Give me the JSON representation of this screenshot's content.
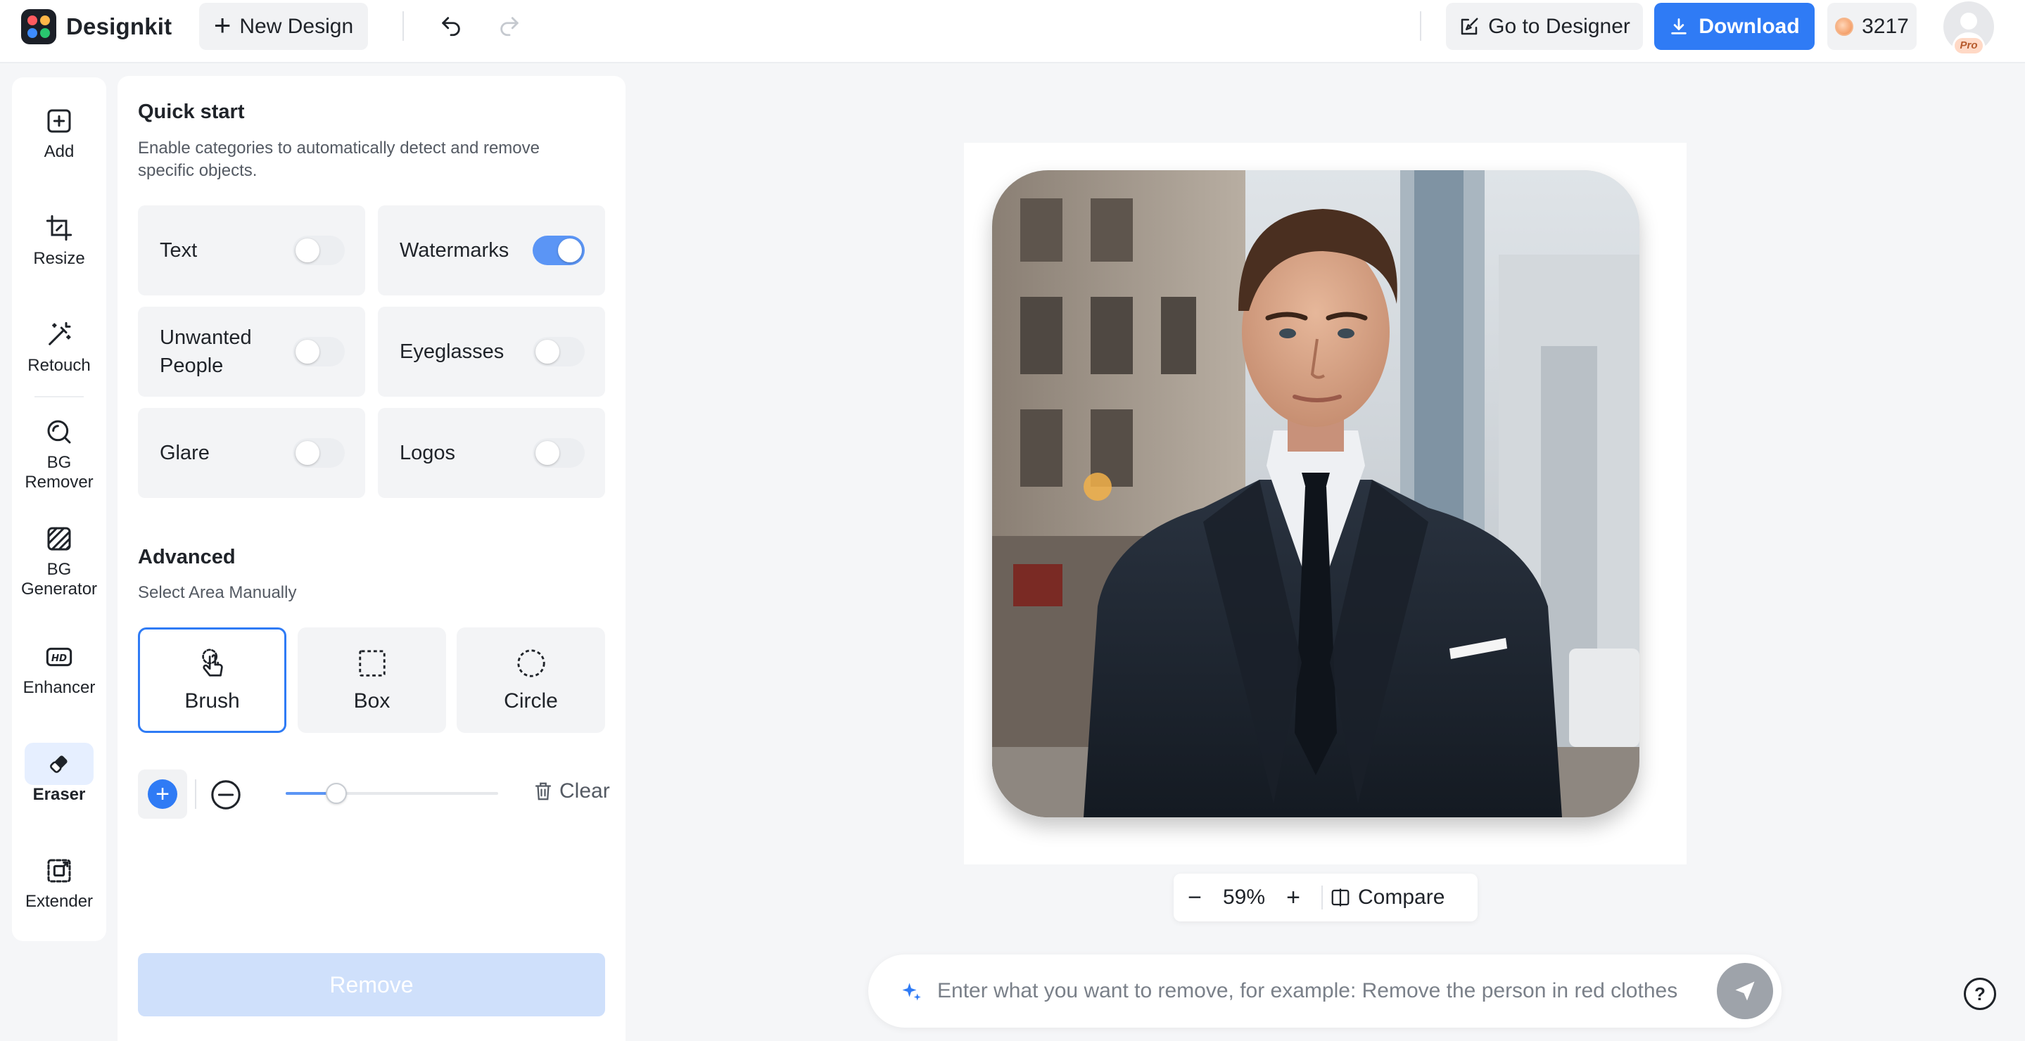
{
  "app": {
    "name": "Designkit"
  },
  "toolbar": {
    "new_design": "New Design",
    "go_to_designer": "Go to Designer",
    "download": "Download",
    "credits": "3217",
    "avatar_badge": "Pro"
  },
  "sidebar": {
    "items": [
      {
        "label": "Add",
        "icon": "add-icon"
      },
      {
        "label": "Resize",
        "icon": "crop-icon"
      },
      {
        "label": "Retouch",
        "icon": "magic-wand-icon"
      },
      {
        "label": "BG Remover",
        "icon": "bg-remover-icon"
      },
      {
        "label": "BG Generator",
        "icon": "bg-generator-icon"
      },
      {
        "label": "Enhancer",
        "icon": "hd-icon"
      },
      {
        "label": "Eraser",
        "icon": "eraser-icon",
        "active": true
      },
      {
        "label": "Extender",
        "icon": "extend-icon"
      }
    ]
  },
  "panel": {
    "quick_start": {
      "title": "Quick start",
      "description": "Enable categories to automatically detect and remove specific objects.",
      "toggles": [
        {
          "label": "Text",
          "on": false
        },
        {
          "label": "Watermarks",
          "on": true
        },
        {
          "label": "Unwanted People",
          "on": false
        },
        {
          "label": "Eyeglasses",
          "on": false
        },
        {
          "label": "Glare",
          "on": false
        },
        {
          "label": "Logos",
          "on": false
        }
      ]
    },
    "advanced": {
      "title": "Advanced",
      "subtitle": "Select Area Manually",
      "tools": [
        {
          "label": "Brush",
          "icon": "brush-hand-icon",
          "selected": true
        },
        {
          "label": "Box",
          "icon": "box-select-icon",
          "selected": false
        },
        {
          "label": "Circle",
          "icon": "circle-select-icon",
          "selected": false
        }
      ],
      "brush_size": 0.24,
      "clear": "Clear"
    },
    "remove_button": "Remove"
  },
  "canvas": {
    "zoom": "59%",
    "compare": "Compare"
  },
  "prompt": {
    "placeholder": "Enter what you want to remove, for example: Remove the person in red clothes"
  },
  "colors": {
    "accent": "#2f7bf5",
    "accent_soft": "#cfe0fb",
    "toggle_on": "#5b95f5"
  }
}
